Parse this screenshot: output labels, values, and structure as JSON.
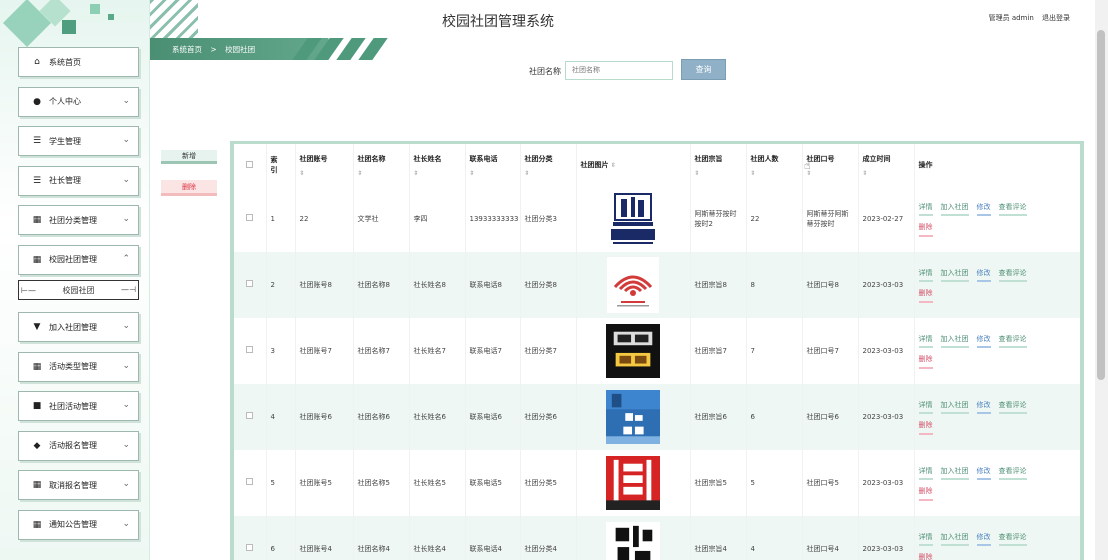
{
  "app": {
    "title": "校园社团管理系统"
  },
  "user": {
    "role_label": "管理员 admin",
    "logout": "退出登录"
  },
  "sidebar": {
    "items": [
      {
        "label": "系统首页",
        "icon": "home-icon",
        "glyph": "⌂",
        "expandable": false
      },
      {
        "label": "个人中心",
        "icon": "user-icon",
        "glyph": "●",
        "expandable": true
      },
      {
        "label": "学生管理",
        "icon": "list-icon",
        "glyph": "☰",
        "expandable": true
      },
      {
        "label": "社长管理",
        "icon": "list-icon",
        "glyph": "☰",
        "expandable": true
      },
      {
        "label": "社团分类管理",
        "icon": "grid-icon",
        "glyph": "▦",
        "expandable": true
      },
      {
        "label": "校园社团管理",
        "icon": "grid-icon",
        "glyph": "▦",
        "expandable": true,
        "expanded": true,
        "children": [
          {
            "label": "校园社团"
          }
        ]
      },
      {
        "label": "加入社团管理",
        "icon": "pin-icon",
        "glyph": "▼",
        "expandable": true
      },
      {
        "label": "活动类型管理",
        "icon": "grid-icon",
        "glyph": "▦",
        "expandable": true
      },
      {
        "label": "社团活动管理",
        "icon": "monitor-icon",
        "glyph": "■",
        "expandable": true
      },
      {
        "label": "活动报名管理",
        "icon": "thumb-icon",
        "glyph": "◆",
        "expandable": true
      },
      {
        "label": "取消报名管理",
        "icon": "grid-icon",
        "glyph": "▦",
        "expandable": true
      },
      {
        "label": "通知公告管理",
        "icon": "grid-icon",
        "glyph": "▦",
        "expandable": true
      }
    ]
  },
  "breadcrumb": {
    "home": "系统首页",
    "separator": ">",
    "current": "校园社团"
  },
  "search": {
    "label": "社团名称",
    "placeholder": "社团名称",
    "button": "查询"
  },
  "actions": {
    "add": "新增",
    "delete": "删除"
  },
  "table": {
    "headers": [
      "索引",
      "社团账号",
      "社团名称",
      "社长姓名",
      "联系电话",
      "社团分类",
      "社团图片",
      "社团宗旨",
      "社团人数",
      "社团口号",
      "成立时间",
      "操作"
    ],
    "header_index_line1": "索",
    "header_index_line2": "引",
    "sort_glyph": "⇳",
    "ops": {
      "view": "详情",
      "join": "加入社团",
      "edit": "修改",
      "review": "查看评论",
      "delete": "删除"
    },
    "rows": [
      {
        "index": "1",
        "account": "22",
        "name": "文学社",
        "leader": "李四",
        "phone": "13933333333",
        "category": "社团分类3",
        "purpose": "阿斯蒂芬按时按时2",
        "members": "22",
        "slogan": "阿斯蒂芬阿斯蒂芬按时",
        "founded": "2023-02-27",
        "image": {
          "kind": "poetry",
          "bg": "#ffffff",
          "fg": "#1a2a66"
        }
      },
      {
        "index": "2",
        "account": "社团账号8",
        "name": "社团名称8",
        "leader": "社长姓名8",
        "phone": "联系电话8",
        "category": "社团分类8",
        "purpose": "社团宗旨8",
        "members": "8",
        "slogan": "社团口号8",
        "founded": "2023-03-03",
        "image": {
          "kind": "waves",
          "bg": "#ffffff",
          "fg": "#d33a3a"
        }
      },
      {
        "index": "3",
        "account": "社团账号7",
        "name": "社团名称7",
        "leader": "社长姓名7",
        "phone": "联系电话7",
        "category": "社团分类7",
        "purpose": "社团宗旨7",
        "members": "7",
        "slogan": "社团口号7",
        "founded": "2023-03-03",
        "image": {
          "kind": "night",
          "bg": "#111111",
          "fg": "#f5c842"
        }
      },
      {
        "index": "4",
        "account": "社团账号6",
        "name": "社团名称6",
        "leader": "社长姓名6",
        "phone": "联系电话6",
        "category": "社团分类6",
        "purpose": "社团宗旨6",
        "members": "6",
        "slogan": "社团口号6",
        "founded": "2023-03-03",
        "image": {
          "kind": "photo",
          "bg": "#2e6fb4",
          "fg": "#ffffff"
        }
      },
      {
        "index": "5",
        "account": "社团账号5",
        "name": "社团名称5",
        "leader": "社长姓名5",
        "phone": "联系电话5",
        "category": "社团分类5",
        "purpose": "社团宗旨5",
        "members": "5",
        "slogan": "社团口号5",
        "founded": "2023-03-03",
        "image": {
          "kind": "music",
          "bg": "#d62424",
          "fg": "#ffffff"
        }
      },
      {
        "index": "6",
        "account": "社团账号4",
        "name": "社团名称4",
        "leader": "社长姓名4",
        "phone": "联系电话4",
        "category": "社团分类4",
        "purpose": "社团宗旨4",
        "members": "4",
        "slogan": "社团口号4",
        "founded": "2023-03-03",
        "image": {
          "kind": "calligraphy",
          "bg": "#ffffff",
          "fg": "#111111"
        }
      }
    ]
  },
  "colors": {
    "accent": "#4e8f74",
    "edit": "#4f84c0",
    "danger": "#d5506a",
    "button": "#8fb0c6"
  }
}
